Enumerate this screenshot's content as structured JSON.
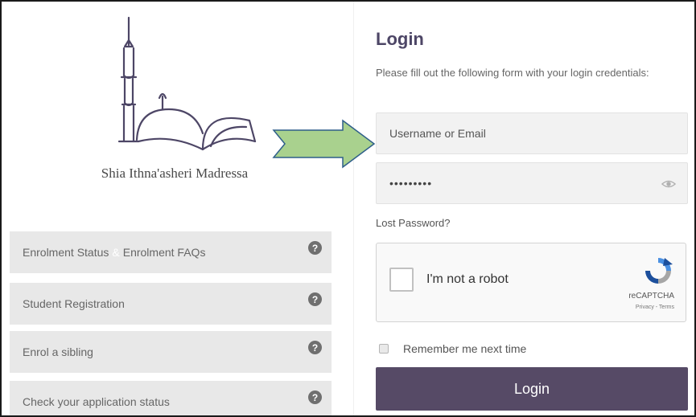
{
  "logo": {
    "text": "Shia Ithna'asheri Madressa"
  },
  "nav": {
    "items": [
      {
        "label_a": "Enrolment Status",
        "separator": "&",
        "label_b": "Enrolment FAQs"
      },
      {
        "label": "Student Registration"
      },
      {
        "label": "Enrol a sibling"
      },
      {
        "label": "Check your application status"
      }
    ],
    "help_glyph": "?"
  },
  "login": {
    "title": "Login",
    "description": "Please fill out the following form with your login credentials:",
    "username_placeholder": "Username or Email",
    "password_value": "•••••••••",
    "lost_password": "Lost Password?",
    "captcha_label": "I'm not a robot",
    "captcha_brand": "reCAPTCHA",
    "captcha_links": "Privacy - Terms",
    "remember_label": "Remember me next time",
    "button_label": "Login"
  },
  "colors": {
    "accent": "#564a66",
    "arrow_fill": "#a9d18e",
    "arrow_stroke": "#2f5f8a"
  },
  "icons": [
    "mosque-book-logo",
    "help-icon",
    "eye-icon",
    "recaptcha-icon",
    "arrow-icon"
  ]
}
